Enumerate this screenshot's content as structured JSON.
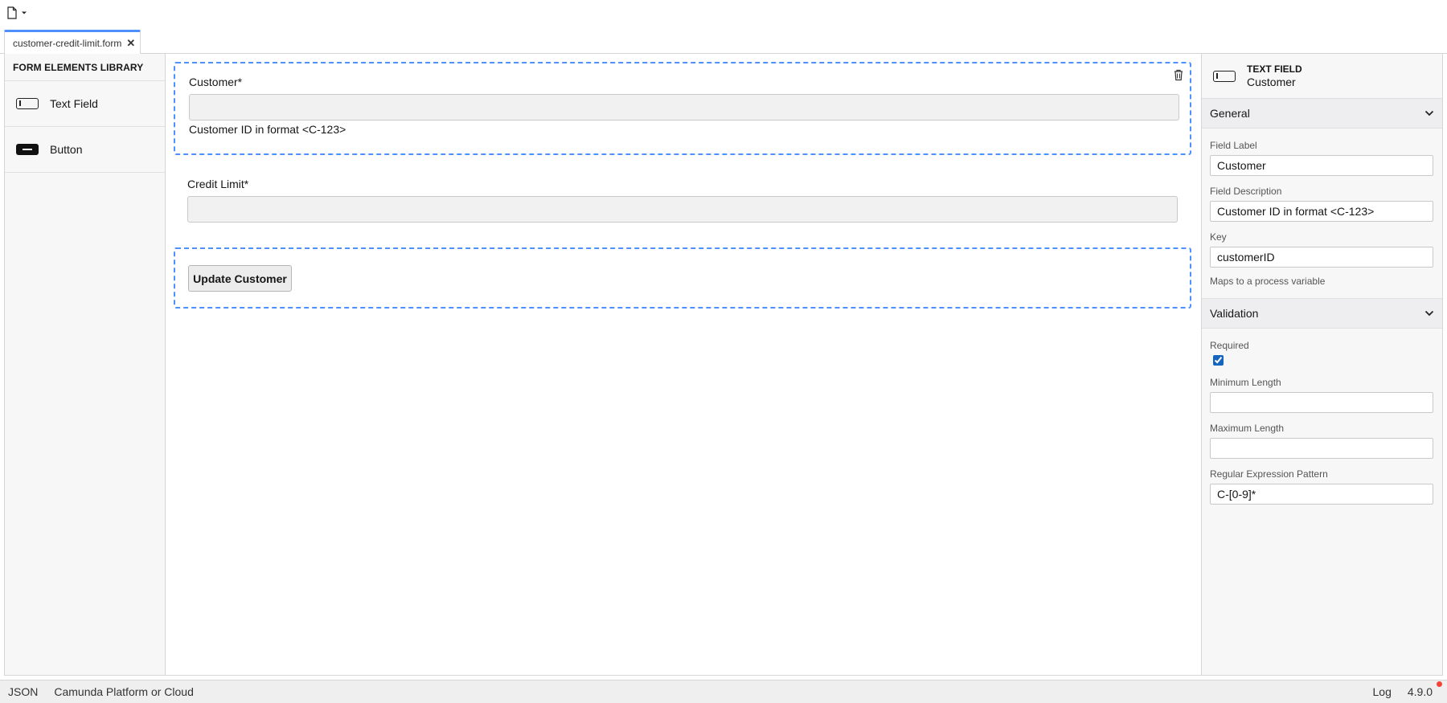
{
  "tab": {
    "title": "customer-credit-limit.form",
    "close_glyph": "✕"
  },
  "palette": {
    "header": "FORM ELEMENTS LIBRARY",
    "items": [
      {
        "label": "Text Field",
        "icon": "textfield-icon"
      },
      {
        "label": "Button",
        "icon": "button-icon"
      }
    ]
  },
  "canvas": {
    "fields": {
      "customer": {
        "label": "Customer*",
        "description": "Customer ID in format <C-123>"
      },
      "credit_limit": {
        "label": "Credit Limit*"
      },
      "button": {
        "label": "Update Customer"
      }
    }
  },
  "properties": {
    "header": {
      "type": "TEXT FIELD",
      "name": "Customer"
    },
    "general": {
      "title": "General",
      "field_label": {
        "label": "Field Label",
        "value": "Customer"
      },
      "field_description": {
        "label": "Field Description",
        "value": "Customer ID in format <C-123>"
      },
      "key": {
        "label": "Key",
        "value": "customerID",
        "hint": "Maps to a process variable"
      }
    },
    "validation": {
      "title": "Validation",
      "required": {
        "label": "Required",
        "checked": true
      },
      "min_length": {
        "label": "Minimum Length",
        "value": ""
      },
      "max_length": {
        "label": "Maximum Length",
        "value": ""
      },
      "regex": {
        "label": "Regular Expression Pattern",
        "value": "C-[0-9]*"
      }
    }
  },
  "statusbar": {
    "json": "JSON",
    "platform": "Camunda Platform or Cloud",
    "log": "Log",
    "version": "4.9.0"
  },
  "colors": {
    "accent": "#4d90fe",
    "notification_dot": "#f44336"
  }
}
